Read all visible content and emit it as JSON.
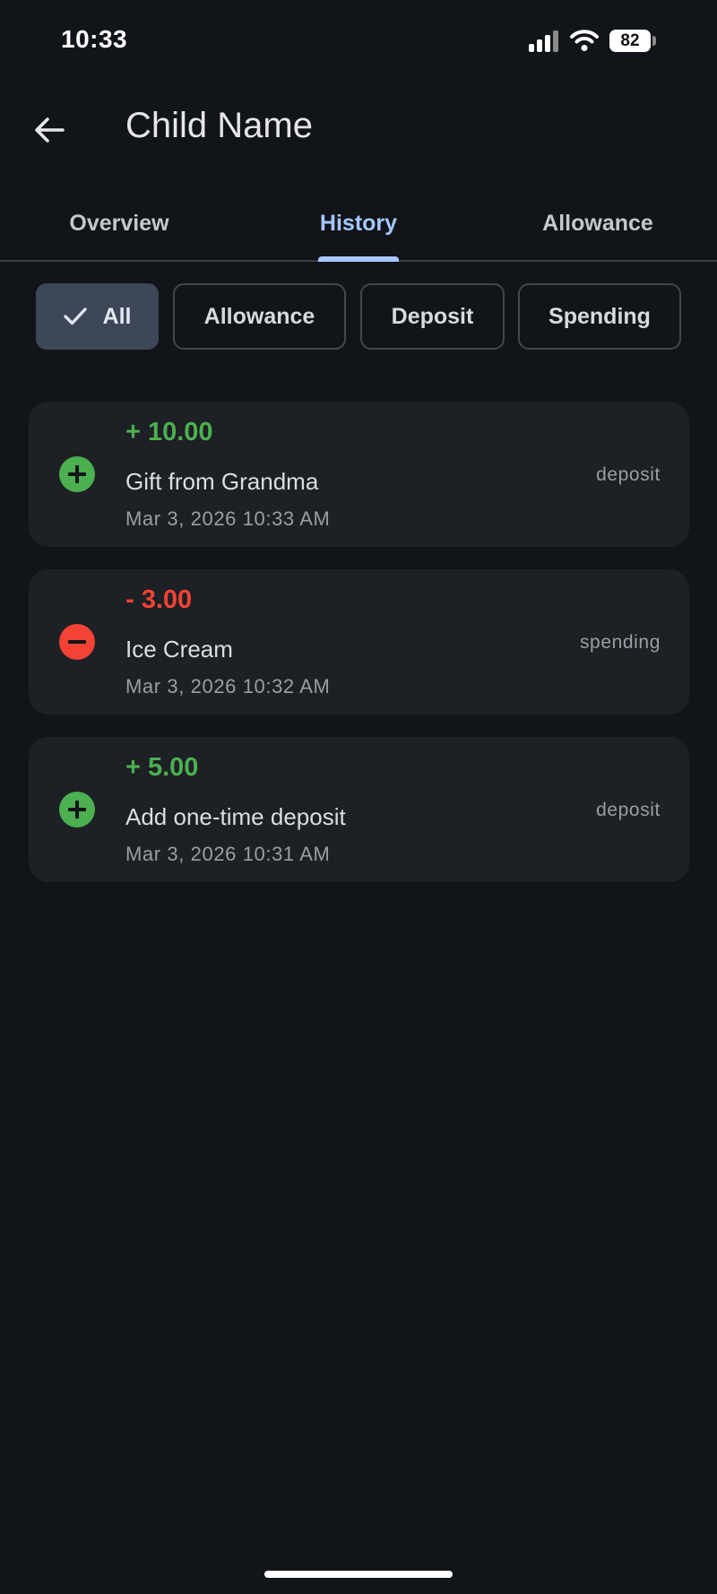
{
  "status_bar": {
    "time": "10:33",
    "battery_level": "82",
    "icons": [
      "signal-icon",
      "wifi-icon",
      "battery-icon"
    ]
  },
  "app_bar": {
    "title": "Child Name",
    "back_icon": "arrow-left-icon"
  },
  "tabs": [
    {
      "label": "Overview",
      "active": false
    },
    {
      "label": "History",
      "active": true
    },
    {
      "label": "Allowance",
      "active": false
    }
  ],
  "filters": [
    {
      "label": "All",
      "selected": true,
      "icon": "check-icon"
    },
    {
      "label": "Allowance",
      "selected": false
    },
    {
      "label": "Deposit",
      "selected": false
    },
    {
      "label": "Spending",
      "selected": false
    }
  ],
  "transactions": [
    {
      "amount": "+ 10.00",
      "description": "Gift from Grandma",
      "date": "Mar 3, 2026 10:33 AM",
      "type": "deposit",
      "icon": "add-circle-icon"
    },
    {
      "amount": "- 3.00",
      "description": "Ice Cream",
      "date": "Mar 3, 2026 10:32 AM",
      "type": "spending",
      "icon": "remove-circle-icon"
    },
    {
      "amount": "+ 5.00",
      "description": "Add one-time deposit",
      "date": "Mar 3, 2026 10:31 AM",
      "type": "deposit",
      "icon": "add-circle-icon"
    }
  ],
  "colors": {
    "background": "#111418",
    "card": "#1d2024",
    "accent": "#a6c8ff",
    "positive": "#4caf50",
    "negative": "#f44336",
    "chip_selected": "#3d4757"
  }
}
